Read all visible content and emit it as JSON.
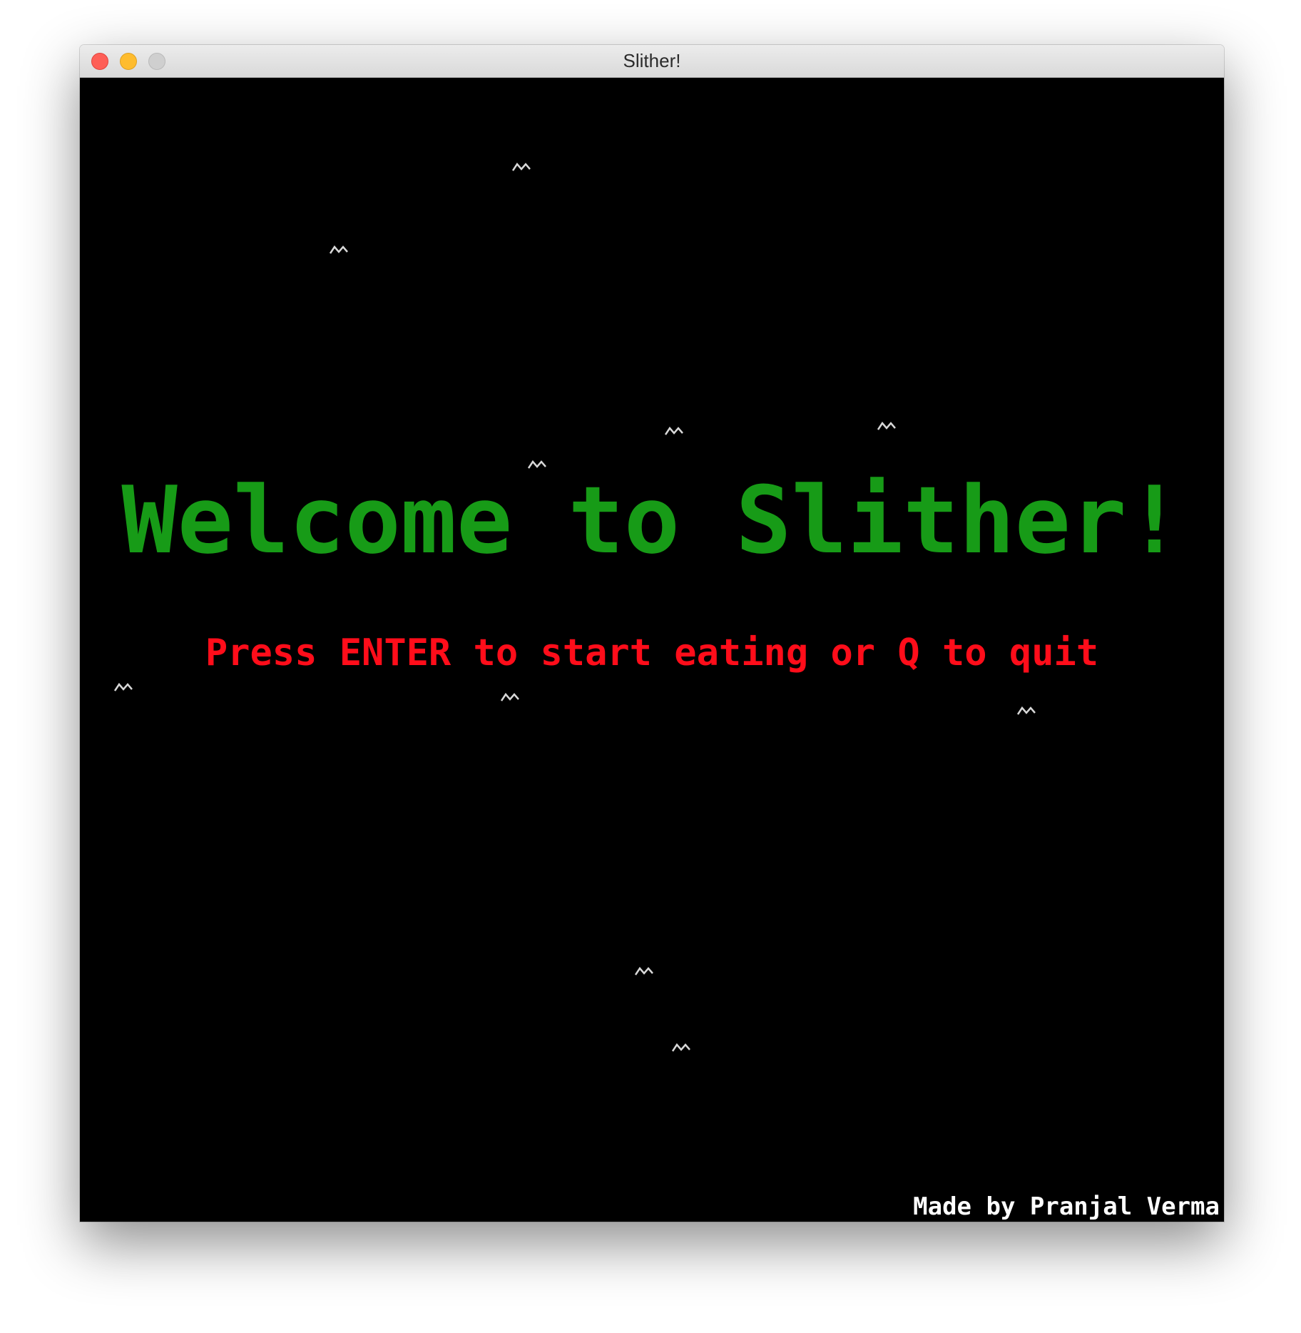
{
  "window": {
    "title": "Slither!"
  },
  "game": {
    "headline": "Welcome to Slither!",
    "prompt": "Press ENTER to start eating or Q to quit",
    "credit": "Made by Pranjal Verma",
    "decoration_icon": "squiggle-icon",
    "colors": {
      "background": "#000000",
      "headline": "#179b17",
      "prompt": "#ff0d1a",
      "credit": "#ffffff"
    }
  }
}
